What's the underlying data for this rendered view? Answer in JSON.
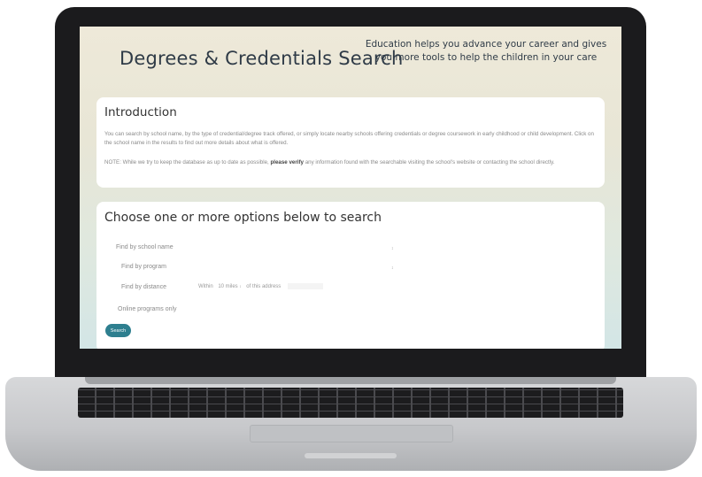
{
  "header": {
    "title": "Degrees & Credentials Search",
    "tagline": "Education helps you advance your career and gives you more tools to help the children in your care"
  },
  "intro": {
    "heading": "Introduction",
    "paragraph1": "You can search by school name, by the type of credential/degree track offered, or simply locate nearby schools offering credentials or degree coursework in early childhood or child development. Click on the school name in the results to find out more details about what is offered.",
    "paragraph2_prefix": "NOTE: While we try to keep the database as up to date as possible,",
    "paragraph2_bold": "please verify",
    "paragraph2_suffix": "any information found with the searchable visiting the school's website or contacting the school directly."
  },
  "options": {
    "heading": "Choose one or more options below to search",
    "school_name_label": "Find by school name",
    "program_label": "Find by program",
    "distance_label": "Find by distance",
    "distance_within": "Within",
    "distance_miles": "10 miles",
    "distance_of_address": "of this address",
    "online_label": "Online programs only",
    "search_button": "Search",
    "select_arrow": "↕"
  },
  "colors": {
    "accent": "#2e7f8f",
    "lid": "#1b1b1d",
    "title_text": "#2f3b47"
  }
}
